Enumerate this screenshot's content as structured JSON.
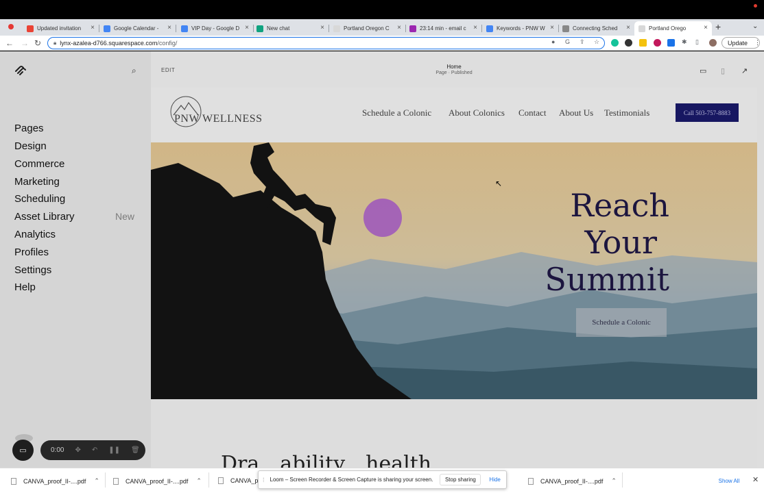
{
  "browser": {
    "tabs": [
      {
        "label": "Updated invitation",
        "color": "#ea4335"
      },
      {
        "label": "Google Calendar -",
        "color": "#4285f4"
      },
      {
        "label": "VIP Day - Google D",
        "color": "#4285f4"
      },
      {
        "label": "New chat",
        "color": "#10a37f"
      },
      {
        "label": "Portland Oregon C",
        "color": "#d8d8d8"
      },
      {
        "label": "23:14 min - email c",
        "color": "#9c27b0"
      },
      {
        "label": "Keywords - PNW W",
        "color": "#4285f4"
      },
      {
        "label": "Connecting Sched",
        "color": "#888888"
      },
      {
        "label": "Portland Orego",
        "color": "#d8d8d8"
      }
    ],
    "url_host": "lynx-azalea-d766.squarespace.com",
    "url_path": "/config/",
    "update_label": "Update"
  },
  "sidebar": {
    "items": [
      {
        "label": "Pages"
      },
      {
        "label": "Design"
      },
      {
        "label": "Commerce"
      },
      {
        "label": "Marketing"
      },
      {
        "label": "Scheduling"
      },
      {
        "label": "Asset Library"
      },
      {
        "label": "Analytics"
      },
      {
        "label": "Profiles"
      },
      {
        "label": "Settings"
      },
      {
        "label": "Help"
      }
    ],
    "new_badge": "New"
  },
  "recorder": {
    "time": "0:00"
  },
  "editor": {
    "edit_label": "EDIT",
    "page_name": "Home",
    "page_status": "Page · Published"
  },
  "site": {
    "logo_text": "PNW WELLNESS",
    "nav": [
      "Schedule a Colonic",
      "About Colonics",
      "Contact",
      "About Us",
      "Testimonials"
    ],
    "call_button": "Call 503-757-8883",
    "hero_title_lines": [
      "Reach",
      "Your",
      "Summit"
    ],
    "hero_button": "Schedule a Colonic",
    "below_heading": "Dra…ability…health…"
  },
  "downloads": {
    "items": [
      "CANVA_proof_II-....pdf",
      "CANVA_proof_II-....pdf",
      "CANVA_pr",
      "CANVA_proof_II-....pdf"
    ],
    "show_all": "Show All"
  },
  "loom": {
    "message": "Loom – Screen Recorder & Screen Capture is sharing your screen.",
    "stop_label": "Stop sharing",
    "hide_label": "Hide"
  }
}
